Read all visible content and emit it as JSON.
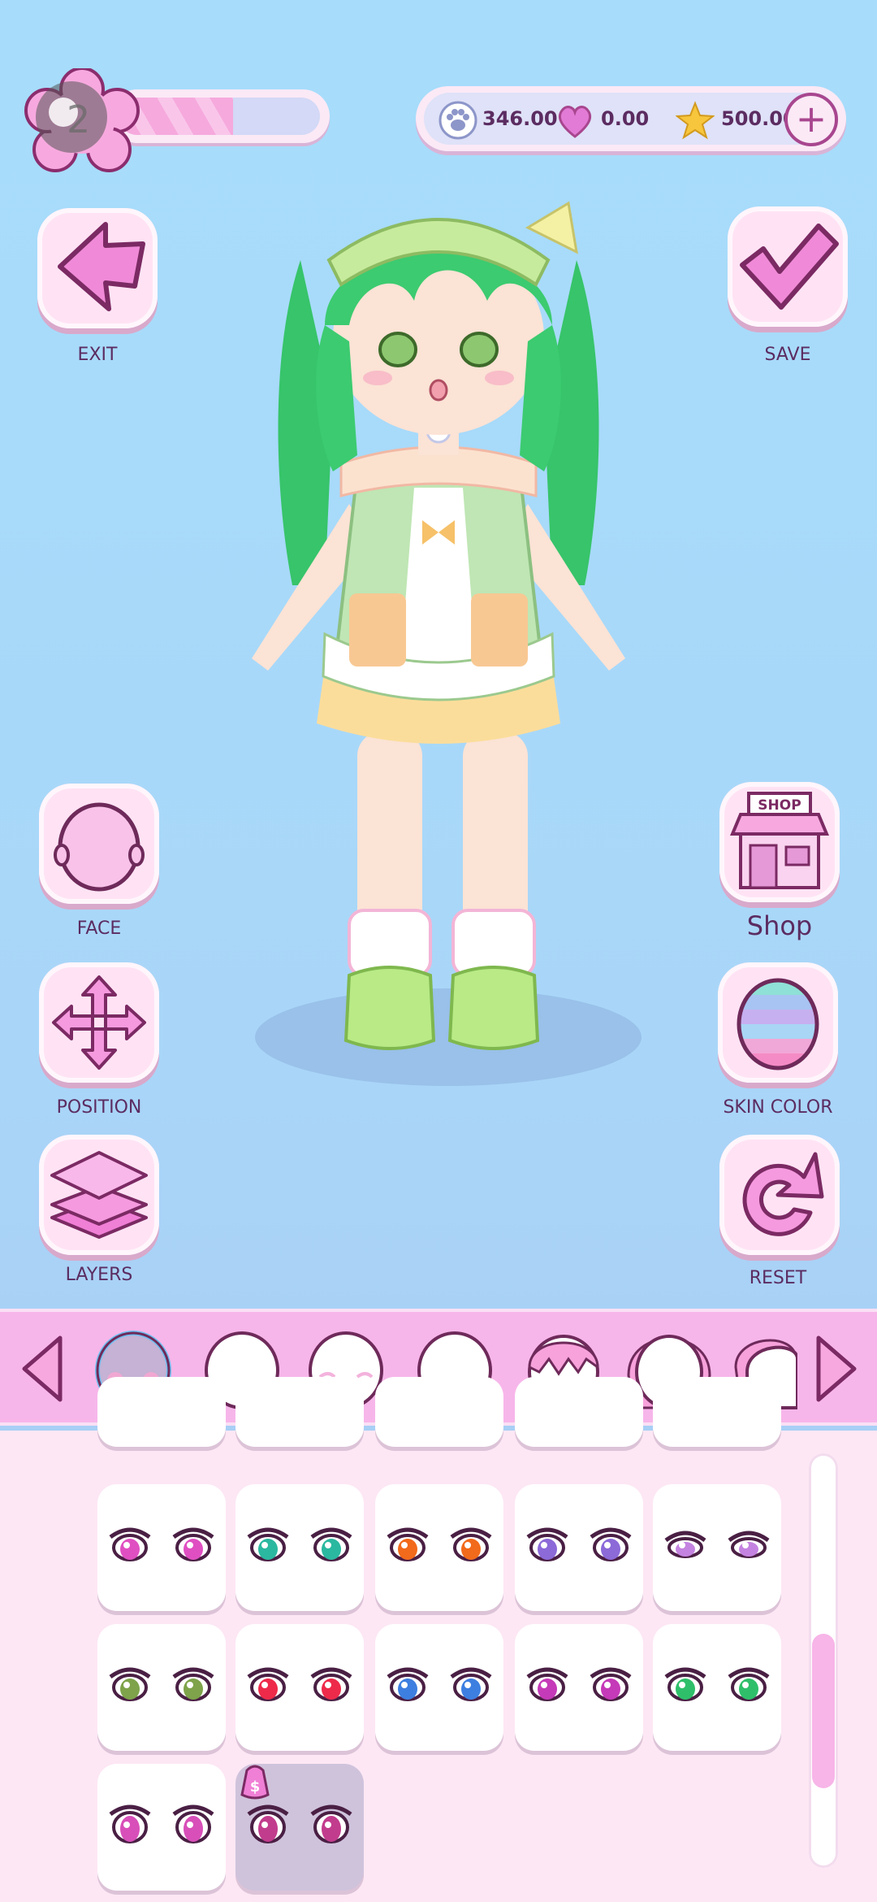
{
  "colors": {
    "accent": "#a8468f",
    "button_bg": "#ffe3f4",
    "category_bar": "#f7b6ea",
    "panel_bg": "#fde7f4",
    "label": "#5b2c61"
  },
  "level": {
    "value": "2",
    "progress": 0.57
  },
  "currency": {
    "paws": "346.00",
    "hearts": "0.00",
    "stars": "500.00"
  },
  "left_buttons": [
    {
      "label": "EXIT",
      "icon": "back-arrow-icon"
    },
    {
      "label": "FACE",
      "icon": "face-icon"
    },
    {
      "label": "POSITION",
      "icon": "move-arrows-icon"
    },
    {
      "label": "LAYERS",
      "icon": "layers-icon"
    }
  ],
  "right_buttons": [
    {
      "label": "SAVE",
      "icon": "checkmark-icon"
    },
    {
      "label": "Shop",
      "icon": "shop-icon",
      "sign": "SHOP"
    },
    {
      "label": "SKIN COLOR",
      "icon": "rainbow-head-icon"
    },
    {
      "label": "RESET",
      "icon": "reset-icon"
    }
  ],
  "categories": [
    {
      "name": "blush",
      "selected": true
    },
    {
      "name": "mouth",
      "selected": false
    },
    {
      "name": "eyes-closed",
      "selected": false
    },
    {
      "name": "cheeks",
      "selected": false
    },
    {
      "name": "hair-bangs",
      "selected": false
    },
    {
      "name": "hair-back",
      "selected": false
    },
    {
      "name": "hair-side",
      "selected": false
    }
  ],
  "eye_options": [
    {
      "iris": "#e04fc2",
      "style": "round"
    },
    {
      "iris": "#2bb8a0",
      "style": "round"
    },
    {
      "iris": "#f26a1b",
      "style": "round"
    },
    {
      "iris": "#8c6ad8",
      "style": "round"
    },
    {
      "iris": "#c483e0",
      "style": "narrow"
    },
    {
      "iris": "#7ea34a",
      "style": "round"
    },
    {
      "iris": "#ee2a4a",
      "style": "round"
    },
    {
      "iris": "#3d7fe0",
      "style": "round"
    },
    {
      "iris": "#c53ab8",
      "style": "round"
    },
    {
      "iris": "#2fbf6a",
      "style": "round"
    },
    {
      "iris": "#d84fb9",
      "style": "big"
    },
    {
      "iris": "#c23c8d",
      "style": "big",
      "locked": true
    }
  ],
  "scroll": {
    "position": 0.7
  }
}
